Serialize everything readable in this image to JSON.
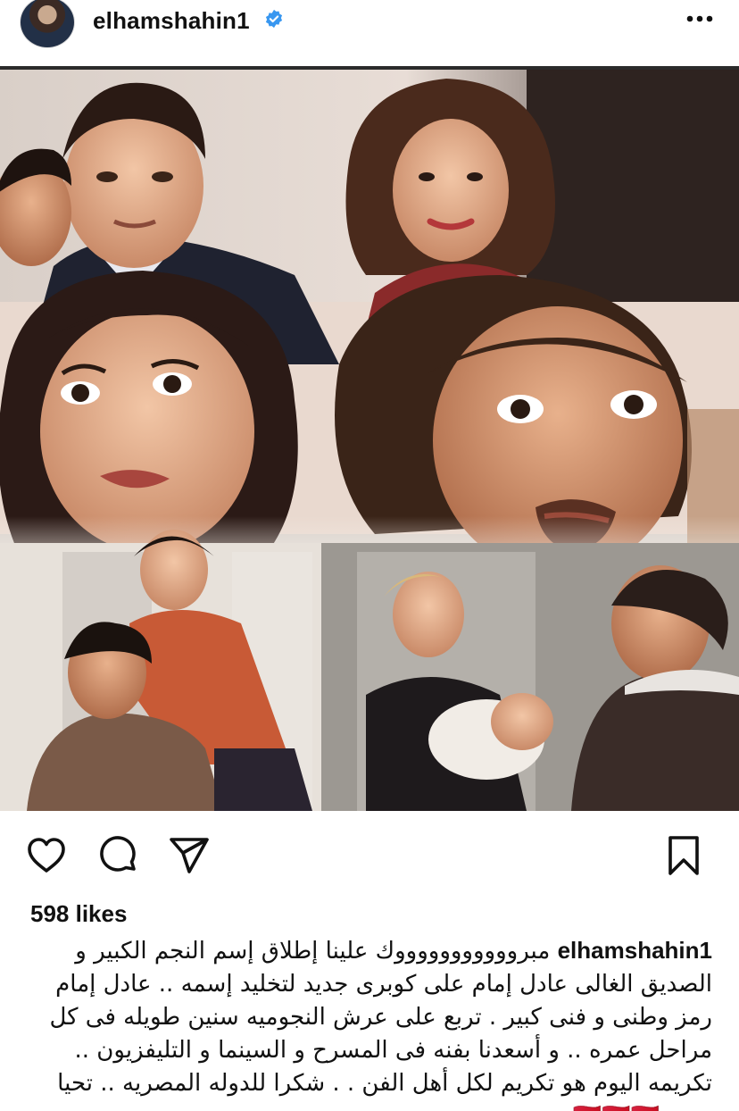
{
  "post": {
    "username": "elhamshahin1",
    "likes": "598 likes",
    "caption_text": "مبروووووووووووك علينا إطلاق إسم النجم الكبير و الصديق الغالى عادل إمام على كوبرى جديد لتخليد إسمه .. عادل إمام رمز وطنى و فنى كبير . تربع على عرش النجوميه سنين طويله فى كل مراحل عمره .. و أسعدنا بفنه فى المسرح و السينما و التليفزيون .. تكريمه اليوم هو تكريم لكل أهل الفن . . شكرا للدوله المصريه .. تحيا مصر 🇪🇬🇪🇬🇪🇬"
  },
  "icons": {
    "verified": "verified-badge",
    "more": "more-horizontal",
    "like": "heart-outline",
    "comment": "speech-bubble",
    "share": "paper-plane",
    "save": "bookmark-outline"
  },
  "colors": {
    "verified_blue": "#3897f0",
    "text": "#111111",
    "background": "#ffffff"
  }
}
